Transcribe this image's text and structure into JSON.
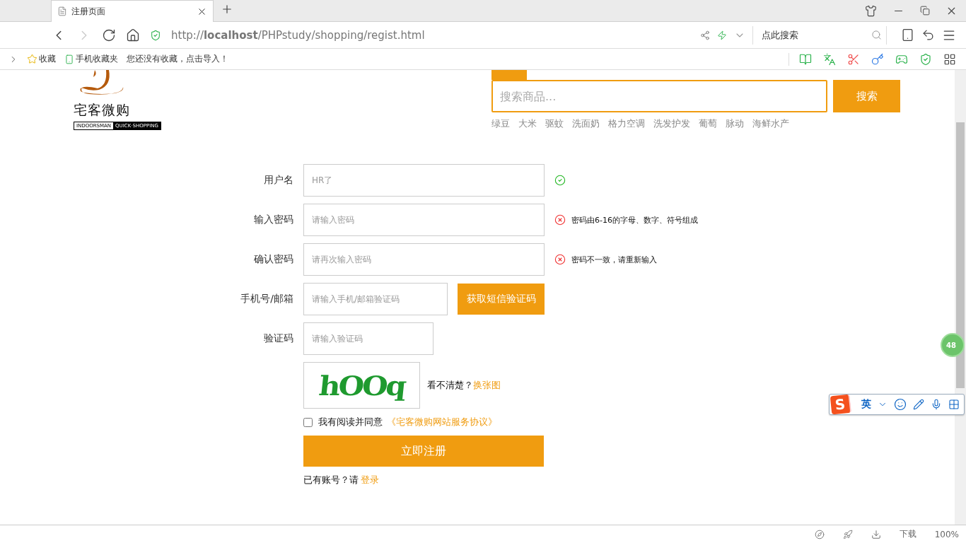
{
  "browser": {
    "tab": {
      "title": "注册页面",
      "selected": true
    },
    "address": {
      "url": "http://**localhost**/PHPstudy/shopping/regist.html",
      "back_disabled": false,
      "forward_disabled": true
    },
    "search": {
      "placeholder": "点此搜索"
    },
    "bookmarks": [
      {
        "kind": "star",
        "label": "收藏"
      },
      {
        "kind": "phone",
        "label": "手机收藏夹"
      },
      {
        "kind": "plain",
        "label": "您还没有收藏，点击导入！"
      }
    ]
  },
  "header": {
    "logo": {
      "name": "宅客微购",
      "tag_left": "INDOORSMAN",
      "tag_right": "QUICK·SHOPPING"
    },
    "search": {
      "placeholder": "搜索商品...",
      "button": "搜索"
    },
    "hot_words": [
      "绿豆",
      "大米",
      "驱蚊",
      "洗面奶",
      "格力空调",
      "洗发护发",
      "葡萄",
      "脉动",
      "海鲜水产"
    ]
  },
  "form": {
    "fields": [
      {
        "label": "用户名",
        "placeholder": "HR了",
        "kind": "wide",
        "valid": true
      },
      {
        "label": "输入密码",
        "placeholder": "请输入密码",
        "kind": "wide",
        "valid": false,
        "message": "密码由6-16的字母、数字、符号组成"
      },
      {
        "label": "确认密码",
        "placeholder": "请再次输入密码",
        "kind": "wide",
        "valid": false,
        "message": "密码不一致，请重新输入"
      },
      {
        "label": "手机号/邮箱",
        "placeholder": "请输入手机/邮箱验证码",
        "kind": "medium",
        "button": "获取短信验证码"
      },
      {
        "label": "验证码",
        "placeholder": "请输入验证码",
        "kind": "short"
      }
    ],
    "captcha": {
      "code": "hOOq",
      "hint": "看不清楚？",
      "link": "换张图"
    },
    "agree": {
      "checked": false,
      "text": "我有阅读并同意",
      "link": "《宅客微购网站服务协议》"
    },
    "submit": "立即注册",
    "login": {
      "text": "已有账号？请",
      "link": "登录"
    }
  },
  "float_badge": "48",
  "ime": {
    "logo": "S",
    "mode": "英"
  },
  "status_bar": {
    "download": "下载",
    "zoom": "100%"
  }
}
